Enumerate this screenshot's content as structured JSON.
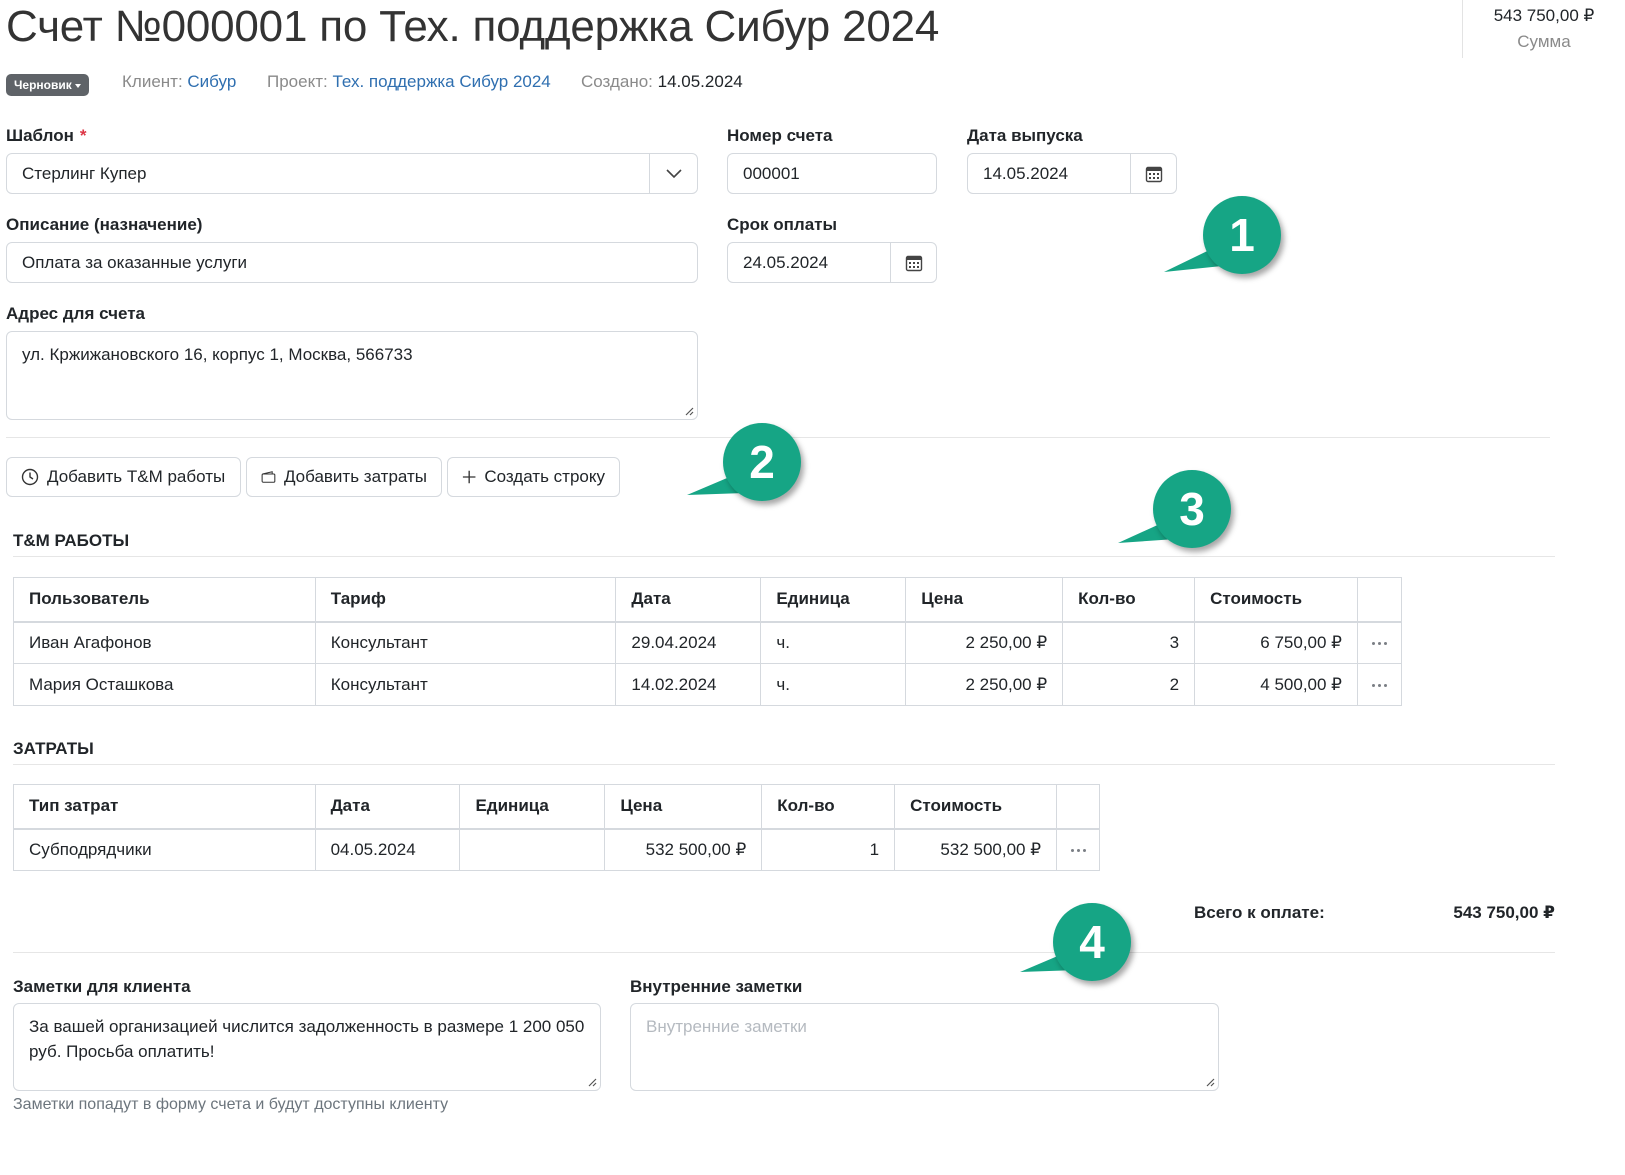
{
  "header": {
    "title": "Счет №000001 по Тех. поддержка Сибур 2024",
    "sum_value": "543 750,00 ₽",
    "sum_label": "Сумма"
  },
  "meta": {
    "status": "Черновик",
    "client_label": "Клиент:",
    "client_value": "Сибур",
    "project_label": "Проект:",
    "project_value": "Тех. поддержка Сибур 2024",
    "created_label": "Создано:",
    "created_value": "14.05.2024"
  },
  "form": {
    "template_label": "Шаблон",
    "template_required": "*",
    "template_value": "Стерлинг Купер",
    "number_label": "Номер счета",
    "number_value": "000001",
    "issue_date_label": "Дата выпуска",
    "issue_date_value": "14.05.2024",
    "description_label": "Описание (назначение)",
    "description_value": "Оплата за оказанные услуги",
    "due_date_label": "Срок оплаты",
    "due_date_value": "24.05.2024",
    "address_label": "Адрес для счета",
    "address_value": "ул. Кржижановского 16, корпус 1, Москва, 566733"
  },
  "toolbar": {
    "add_tm_label": "Добавить T&M работы",
    "add_expenses_label": "Добавить затраты",
    "create_row_label": "Создать строку"
  },
  "tm_section": {
    "title": "T&M РАБОТЫ",
    "columns": [
      "Пользователь",
      "Тариф",
      "Дата",
      "Единица",
      "Цена",
      "Кол-во",
      "Стоимость"
    ],
    "rows": [
      {
        "user": "Иван Агафонов",
        "rate": "Консультант",
        "date": "29.04.2024",
        "unit": "ч.",
        "price": "2 250,00 ₽",
        "qty": "3",
        "cost": "6 750,00 ₽"
      },
      {
        "user": "Мария Осташкова",
        "rate": "Консультант",
        "date": "14.02.2024",
        "unit": "ч.",
        "price": "2 250,00 ₽",
        "qty": "2",
        "cost": "4 500,00 ₽"
      }
    ]
  },
  "expenses_section": {
    "title": "ЗАТРАТЫ",
    "columns": [
      "Тип затрат",
      "Дата",
      "Единица",
      "Цена",
      "Кол-во",
      "Стоимость"
    ],
    "rows": [
      {
        "type": "Субподрядчики",
        "date": "04.05.2024",
        "unit": "",
        "price": "532 500,00 ₽",
        "qty": "1",
        "cost": "532 500,00 ₽"
      }
    ]
  },
  "totals": {
    "label": "Всего к оплате:",
    "value": "543 750,00 ₽"
  },
  "notes": {
    "client_label": "Заметки для клиента",
    "client_value_line1": "За вашей организацией числится задолженность в размере 1 200 050",
    "client_value_line2": "руб. Просьба оплатить!",
    "client_hint": "Заметки попадут в форму счета и будут доступны клиенту",
    "internal_label": "Внутренние заметки",
    "internal_placeholder": "Внутренние заметки"
  },
  "markers": [
    "1",
    "2",
    "3",
    "4"
  ],
  "colors": {
    "marker": "#16a585",
    "link": "#2f6fb0",
    "badge": "#5f6368",
    "required": "#dc3545"
  }
}
